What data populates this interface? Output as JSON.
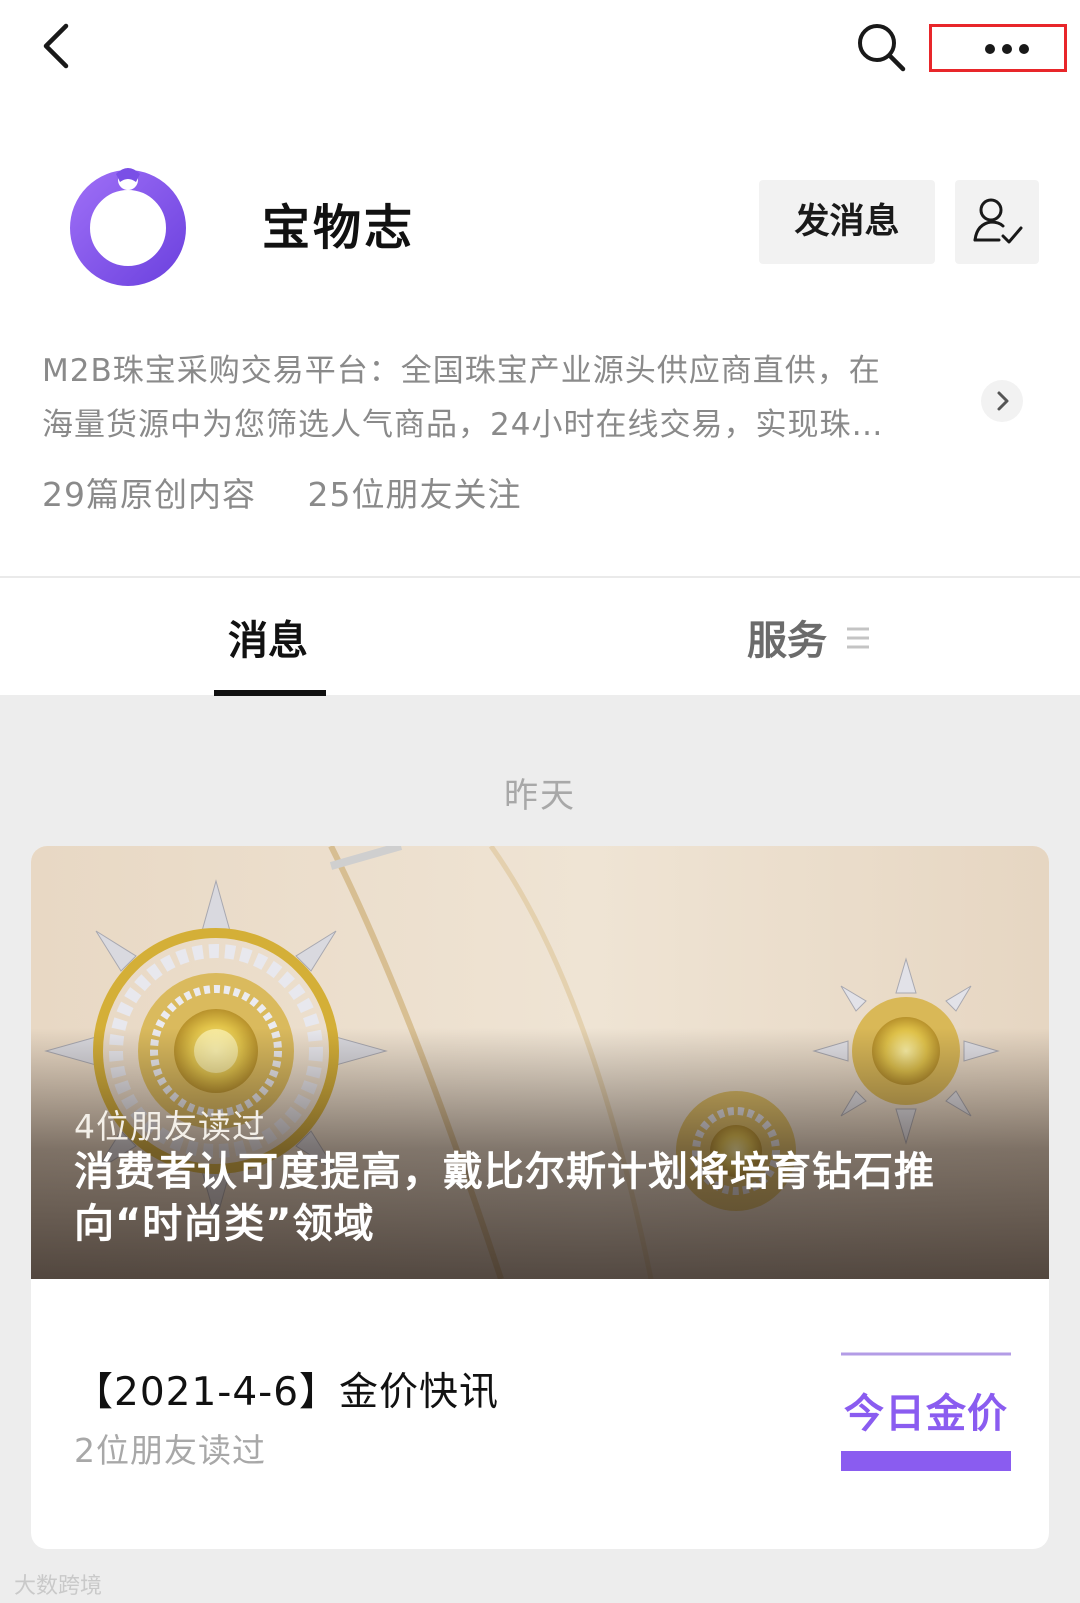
{
  "account": {
    "name": "宝物志",
    "message_button": "发消息",
    "description_line1": "M2B珠宝采购交易平台：全国珠宝产业源头供应商直供，在",
    "description_line2": "海量货源中为您筛选人气商品，24小时在线交易，实现珠…",
    "original_count": "29篇原创内容",
    "followers": "25位朋友关注"
  },
  "tabs": [
    {
      "label": "消息",
      "active": true
    },
    {
      "label": "服务",
      "active": false
    }
  ],
  "feed": {
    "date_label": "昨天",
    "articles": [
      {
        "readers": "4位朋友读过",
        "title": "消费者认可度提高，戴比尔斯计划将培育钻石推向“时尚类”领域"
      },
      {
        "title": "【2021-4-6】金价快讯",
        "readers": "2位朋友读过",
        "thumbnail_text": "今日金价"
      }
    ]
  },
  "watermark": "大数跨境",
  "colors": {
    "accent": "#8a5cf0",
    "highlight_border": "#e8262a",
    "background": "#ededed"
  }
}
